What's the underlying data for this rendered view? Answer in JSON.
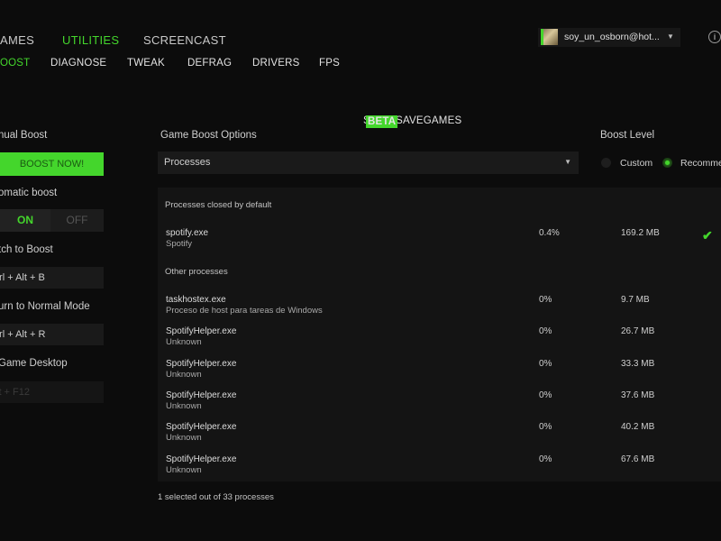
{
  "top_nav": {
    "tabs": [
      {
        "label": "AMES",
        "active": false
      },
      {
        "label": "UTILITIES",
        "active": true
      },
      {
        "label": "SCREENCAST",
        "active": false
      }
    ]
  },
  "sub_nav": {
    "tabs": [
      {
        "label": "OOST",
        "active": true
      },
      {
        "label": "DIAGNOSE",
        "active": false
      },
      {
        "label": "TWEAK",
        "active": false
      },
      {
        "label": "DEFRAG",
        "active": false
      },
      {
        "label": "DRIVERS",
        "active": false
      },
      {
        "label": "FPS",
        "active": false
      },
      {
        "label": "SYNC SAVEGAMES",
        "active": false,
        "badge": "BETA"
      }
    ]
  },
  "user": {
    "email": "soy_un_osborn@hot...",
    "dropdown_icon": "chevron-down-icon"
  },
  "info_icon": "info-icon",
  "left_panel": {
    "manual_boost_label": "nual Boost",
    "boost_now_label": "BOOST NOW!",
    "automatic_boost_label": "omatic boost",
    "toggle_on": "ON",
    "toggle_off": "OFF",
    "switch_to_boost_label": "tch to Boost",
    "switch_to_boost_keys": "trl + Alt + B",
    "return_normal_label": "urn to Normal Mode",
    "return_normal_keys": "trl + Alt + R",
    "game_desktop_label": "Game Desktop",
    "game_desktop_keys": "lt + F12"
  },
  "options": {
    "title": "Game Boost Options",
    "select_value": "Processes"
  },
  "boost_level": {
    "title": "Boost Level",
    "options": [
      {
        "label": "Custom",
        "checked": false
      },
      {
        "label": "Recommen",
        "checked": true
      }
    ]
  },
  "process_panel": {
    "closed_by_default_header": "Processes closed by default",
    "closed_by_default": [
      {
        "name": "spotify.exe",
        "desc": "Spotify",
        "cpu": "0.4%",
        "mem": "169.2 MB",
        "selected": true
      }
    ],
    "other_header": "Other processes",
    "other": [
      {
        "name": "taskhostex.exe",
        "desc": "Proceso de host para tareas de Windows",
        "cpu": "0%",
        "mem": "9.7 MB"
      },
      {
        "name": "SpotifyHelper.exe",
        "desc": "Unknown",
        "cpu": "0%",
        "mem": "26.7 MB"
      },
      {
        "name": "SpotifyHelper.exe",
        "desc": "Unknown",
        "cpu": "0%",
        "mem": "33.3 MB"
      },
      {
        "name": "SpotifyHelper.exe",
        "desc": "Unknown",
        "cpu": "0%",
        "mem": "37.6 MB"
      },
      {
        "name": "SpotifyHelper.exe",
        "desc": "Unknown",
        "cpu": "0%",
        "mem": "40.2 MB"
      },
      {
        "name": "SpotifyHelper.exe",
        "desc": "Unknown",
        "cpu": "0%",
        "mem": "67.6 MB"
      }
    ]
  },
  "footer": {
    "status": "1 selected out of 33 processes"
  },
  "colors": {
    "accent": "#44d62c",
    "background": "#0c0c0c",
    "panel": "#141414"
  }
}
